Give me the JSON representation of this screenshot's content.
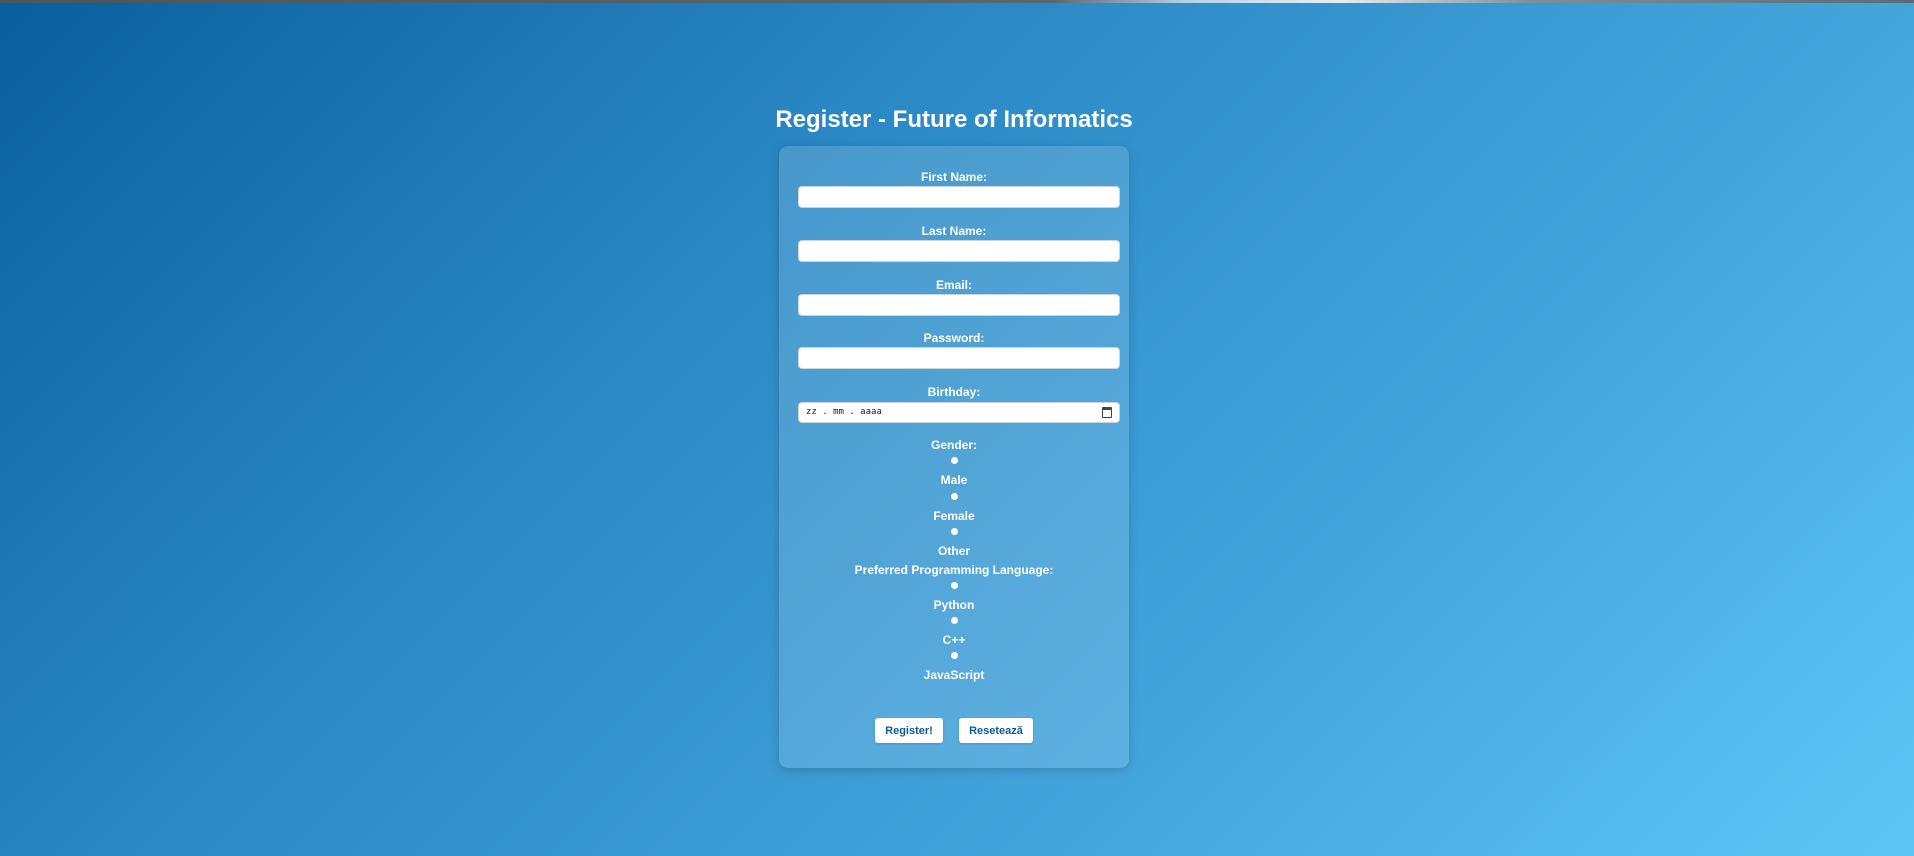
{
  "page": {
    "title": "Register - Future of Informatics"
  },
  "form": {
    "first_name": {
      "label": "First Name:",
      "value": "",
      "placeholder": ""
    },
    "last_name": {
      "label": "Last Name:",
      "value": "",
      "placeholder": ""
    },
    "email": {
      "label": "Email:",
      "value": "",
      "placeholder": ""
    },
    "password": {
      "label": "Password:",
      "value": "",
      "placeholder": ""
    },
    "birthday": {
      "label": "Birthday:",
      "placeholder": "zz . mm . aaaa",
      "icon": "calendar-icon"
    },
    "gender": {
      "label": "Gender:",
      "options": [
        "Male",
        "Female",
        "Other"
      ],
      "selected": ""
    },
    "language": {
      "label": "Preferred Programming Language:",
      "options": [
        "Python",
        "C++",
        "JavaScript"
      ],
      "selected": ""
    },
    "submit_label": "Register!",
    "reset_label": "Resetează"
  },
  "colors": {
    "background_start": "#0a5f9e",
    "background_end": "#5ec6f7",
    "button_text": "#0c5c9a",
    "text": "#ffffff"
  }
}
